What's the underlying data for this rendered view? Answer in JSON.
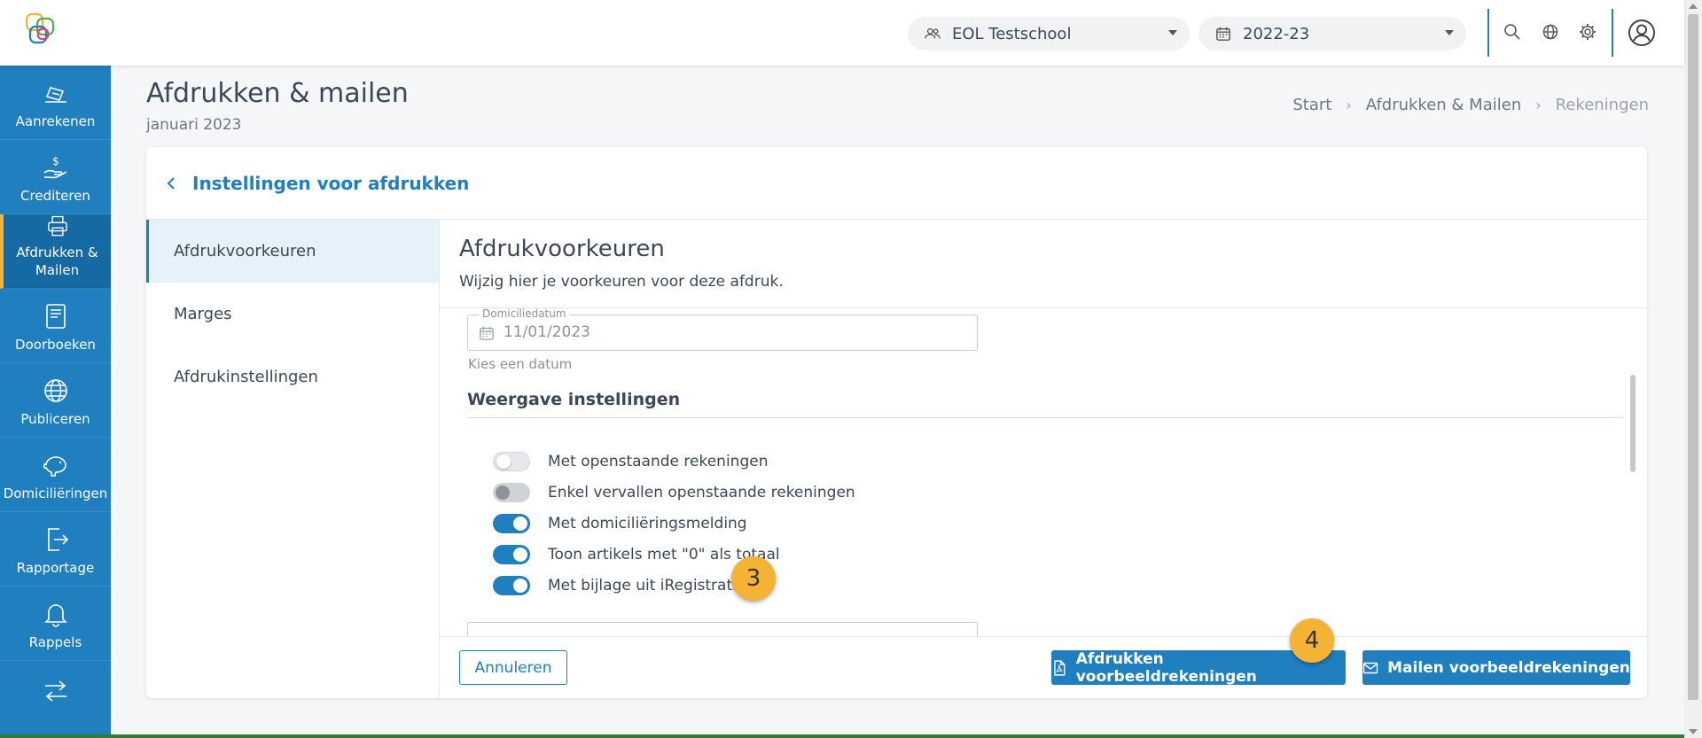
{
  "topbar": {
    "school": "EOL Testschool",
    "year": "2022-23"
  },
  "sidebar": {
    "items": [
      {
        "label": "Aanrekenen",
        "icon": "invoice-icon"
      },
      {
        "label": "Crediteren",
        "icon": "hand-dollar-icon"
      },
      {
        "label": "Afdrukken & Mailen",
        "icon": "printer-icon"
      },
      {
        "label": "Doorboeken",
        "icon": "book-icon"
      },
      {
        "label": "Publiceren",
        "icon": "globe-icon"
      },
      {
        "label": "Domiciliëringen",
        "icon": "piggy-bank-icon"
      },
      {
        "label": "Rapportage",
        "icon": "export-icon"
      },
      {
        "label": "Rappels",
        "icon": "bell-icon"
      }
    ]
  },
  "header": {
    "title": "Afdrukken & mailen",
    "subtitle": "januari 2023",
    "breadcrumb": [
      "Start",
      "Afdrukken & Mailen",
      "Rekeningen"
    ]
  },
  "card": {
    "title": "Instellingen voor afdrukken",
    "nav": [
      "Afdrukvoorkeuren",
      "Marges",
      "Afdrukinstellingen"
    ],
    "content_title": "Afdrukvoorkeuren",
    "content_subtitle": "Wijzig hier je voorkeuren voor deze afdruk.",
    "date_label": "Domiciliedatum",
    "date_value": "11/01/2023",
    "date_hint": "Kies een datum",
    "section_title": "Weergave instellingen",
    "toggles": [
      {
        "label": "Met openstaande rekeningen",
        "state": "off"
      },
      {
        "label": "Enkel vervallen openstaande rekeningen",
        "state": "disabled"
      },
      {
        "label": "Met domiciliëringsmelding",
        "state": "on"
      },
      {
        "label": "Toon artikels met \"0\" als totaal",
        "state": "on"
      },
      {
        "label": "Met bijlage uit iRegistratie",
        "state": "on"
      }
    ],
    "cancel_label": "Annuleren",
    "print_label": "Afdrukken voorbeeldrekeningen",
    "mail_label": "Mailen voorbeeldrekeningen"
  },
  "markers": [
    "3",
    "4"
  ],
  "colors": {
    "accent": "#1f7fbf",
    "marker": "#f5b335"
  }
}
